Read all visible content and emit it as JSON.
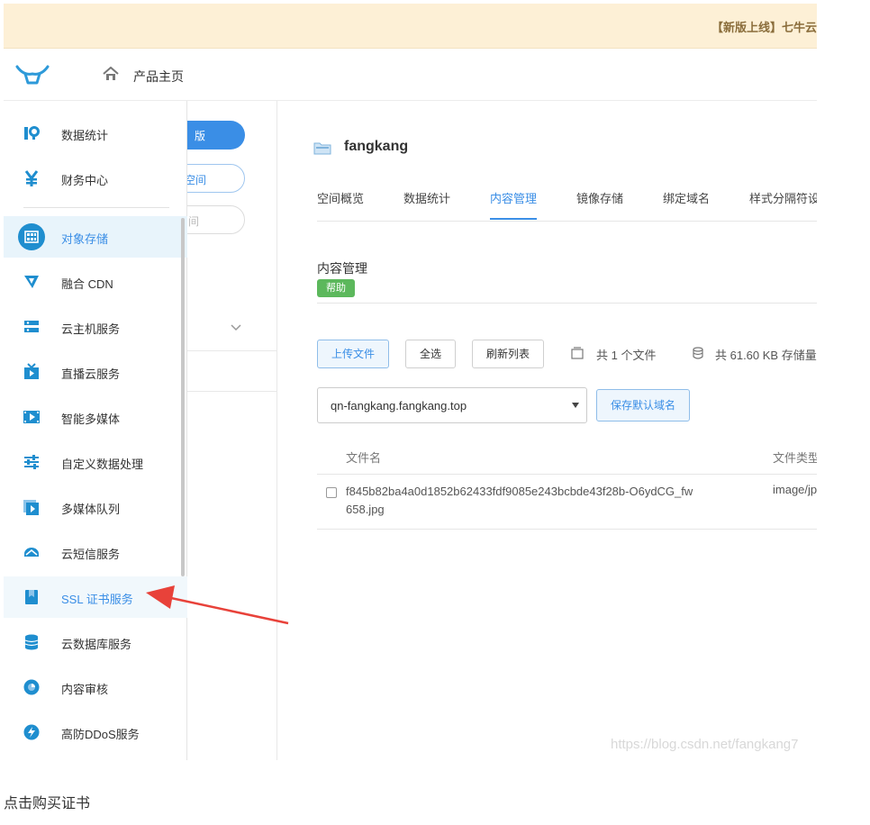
{
  "banner": {
    "text": "【新版上线】七牛云"
  },
  "header": {
    "home_label": "产品主页",
    "logo_icon": "qiniu-logo",
    "home_icon": "home-icon"
  },
  "second_panel": {
    "btn1": "版",
    "btn2": "空间",
    "btn3": "间"
  },
  "sidebar": {
    "items": [
      {
        "label": "数据统计",
        "icon": "chart-icon"
      },
      {
        "label": "财务中心",
        "icon": "yen-icon"
      },
      {
        "label": "对象存储",
        "icon": "storage-icon",
        "state": "active"
      },
      {
        "label": "融合 CDN",
        "icon": "cdn-icon"
      },
      {
        "label": "云主机服务",
        "icon": "server-icon"
      },
      {
        "label": "直播云服务",
        "icon": "live-icon"
      },
      {
        "label": "智能多媒体",
        "icon": "media-icon"
      },
      {
        "label": "自定义数据处理",
        "icon": "sliders-icon"
      },
      {
        "label": "多媒体队列",
        "icon": "queue-icon"
      },
      {
        "label": "云短信服务",
        "icon": "sms-icon"
      },
      {
        "label": "SSL 证书服务",
        "icon": "ssl-icon",
        "state": "hover"
      },
      {
        "label": "云数据库服务",
        "icon": "database-icon"
      },
      {
        "label": "内容审核",
        "icon": "audit-icon"
      },
      {
        "label": "高防DDoS服务",
        "icon": "ddos-icon"
      }
    ]
  },
  "main": {
    "bucket_name": "fangkang",
    "tabs": [
      "空间概览",
      "数据统计",
      "内容管理",
      "镜像存储",
      "绑定域名",
      "样式分隔符设"
    ],
    "active_tab": "内容管理",
    "section_title": "内容管理",
    "help_label": "帮助",
    "toolbar": {
      "upload": "上传文件",
      "select_all": "全选",
      "refresh": "刷新列表",
      "file_count": "共 1 个文件",
      "storage": "共 61.60 KB 存储量"
    },
    "domain_select": {
      "value": "qn-fangkang.fangkang.top"
    },
    "save_domain": "保存默认域名",
    "table": {
      "headers": [
        "文件名",
        "文件类型"
      ],
      "rows": [
        {
          "name": "f845b82ba4a0d1852b62433fdf9085e243bcbde43f28b-O6ydCG_fw658.jpg",
          "type": "image/jp"
        }
      ]
    }
  },
  "watermark": "https://blog.csdn.net/fangkang7",
  "caption": "点击购买证书",
  "colors": {
    "accent": "#3a8ee6",
    "help": "#5cb85c",
    "arrow": "#e8423a",
    "banner": "#fdf0d6"
  }
}
